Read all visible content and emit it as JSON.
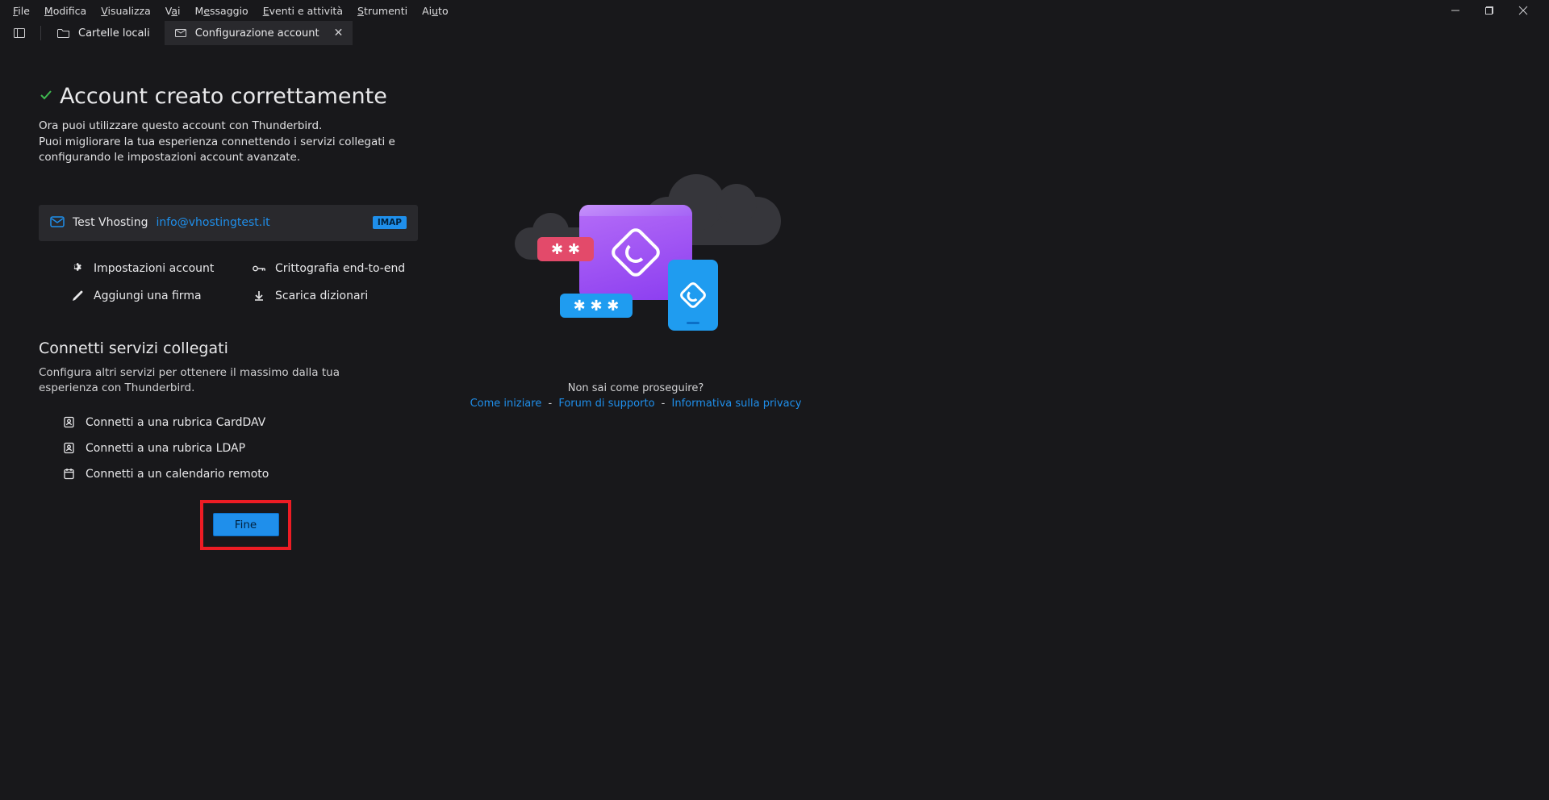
{
  "menu": {
    "file": "<u>F</u>ile",
    "edit": "<u>M</u>odifica",
    "view": "<u>V</u>isualizza",
    "go": "V<u>a</u>i",
    "message": "M<u>e</u>ssaggio",
    "events": "<u>E</u>venti e attività",
    "tools": "<u>S</u>trumenti",
    "help": "Ai<u>u</u>to"
  },
  "tabs": {
    "local_folders": "Cartelle locali",
    "config": "Configurazione account"
  },
  "heading": "Account creato correttamente",
  "desc_line1": "Ora puoi utilizzare questo account con Thunderbird.",
  "desc_line2": "Puoi migliorare la tua esperienza connettendo i servizi collegati e configurando le impostazioni account avanzate.",
  "account": {
    "name": "Test Vhosting",
    "email": "info@vhostingtest.it",
    "protocol": "IMAP"
  },
  "actions": {
    "settings": "Impostazioni account",
    "e2e": "Crittografia end-to-end",
    "signature": "Aggiungi una firma",
    "dictionaries": "Scarica dizionari"
  },
  "services": {
    "title": "Connetti servizi collegati",
    "subtitle": "Configura altri servizi per ottenere il massimo dalla tua esperienza con Thunderbird.",
    "carddav": "Connetti a una rubrica CardDAV",
    "ldap": "Connetti a una rubrica LDAP",
    "calendar": "Connetti a un calendario remoto"
  },
  "finish_button": "Fine",
  "help": {
    "question": "Non sai come proseguire?",
    "start": "Come iniziare",
    "forum": "Forum di supporto",
    "privacy": "Informativa sulla privacy"
  }
}
